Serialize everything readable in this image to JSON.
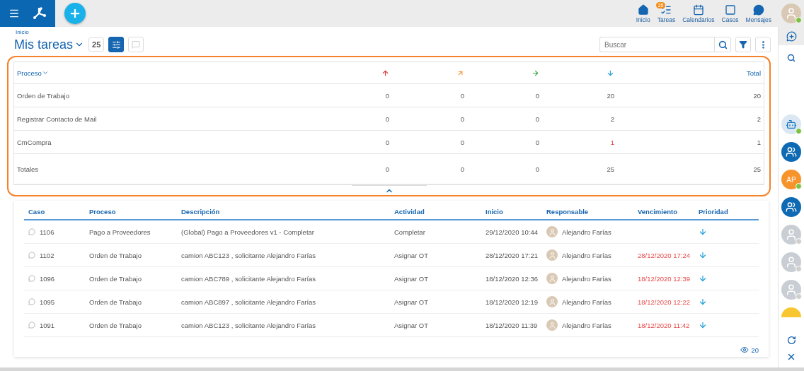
{
  "topbar": {
    "nav": [
      {
        "kind": "home",
        "label": "Inicio"
      },
      {
        "kind": "tasks",
        "label": "Tareas",
        "badge": "25"
      },
      {
        "kind": "calendar",
        "label": "Calendarios"
      },
      {
        "kind": "cases",
        "label": "Casos"
      },
      {
        "kind": "messages",
        "label": "Mensajes"
      }
    ],
    "user": {
      "online": true
    }
  },
  "breadcrumb": "Inicio",
  "title": "Mis tareas",
  "count": "25",
  "search": {
    "placeholder": "Buscar"
  },
  "summary": {
    "process_header": "Proceso",
    "priority_columns": [
      {
        "kind": "urgent"
      },
      {
        "kind": "high"
      },
      {
        "kind": "medium"
      },
      {
        "kind": "low"
      }
    ],
    "total_header": "Total",
    "rows": [
      {
        "name": "Orden de Trabajo",
        "counts": [
          "0",
          "0",
          "0",
          "20"
        ],
        "alerts": [
          false,
          false,
          false,
          false
        ],
        "total": "20"
      },
      {
        "name": "Registrar Contacto de Mail",
        "counts": [
          "0",
          "0",
          "0",
          "2"
        ],
        "alerts": [
          false,
          false,
          false,
          false
        ],
        "total": "2"
      },
      {
        "name": "CmCompra",
        "counts": [
          "0",
          "0",
          "0",
          "1"
        ],
        "alerts": [
          false,
          false,
          false,
          true
        ],
        "total": "1"
      }
    ],
    "totals": {
      "label": "Totales",
      "counts": [
        "0",
        "0",
        "0",
        "25"
      ],
      "total": "25"
    }
  },
  "tasks": {
    "columns": [
      "Caso",
      "Proceso",
      "Descripción",
      "Actividad",
      "Inicio",
      "Responsable",
      "Vencimiento",
      "Prioridad"
    ],
    "rows": [
      {
        "case": "1106",
        "process": "Pago a Proveedores",
        "description": "(Global) Pago a Proveedores v1 - Completar",
        "activity": "Completar",
        "start": "29/12/2020 10:44",
        "responsible": "Alejandro Farías",
        "priority": {
          "kind": "low"
        }
      },
      {
        "case": "1102",
        "process": "Orden de Trabajo",
        "description": "camion ABC123 , solicitante Alejandro Farías",
        "activity": "Asignar OT",
        "start": "28/12/2020 17:21",
        "responsible": "Alejandro Farías",
        "due": "28/12/2020 17:24",
        "priority": {
          "kind": "low"
        }
      },
      {
        "case": "1096",
        "process": "Orden de Trabajo",
        "description": "camion ABC789 , solicitante Alejandro Farías",
        "activity": "Asignar OT",
        "start": "18/12/2020 12:36",
        "responsible": "Alejandro Farías",
        "due": "18/12/2020 12:39",
        "priority": {
          "kind": "low"
        }
      },
      {
        "case": "1095",
        "process": "Orden de Trabajo",
        "description": "camion ABC897 , solicitante Alejandro Farías",
        "activity": "Asignar OT",
        "start": "18/12/2020 12:19",
        "responsible": "Alejandro Farías",
        "due": "18/12/2020 12:22",
        "priority": {
          "kind": "low"
        }
      },
      {
        "case": "1091",
        "process": "Orden de Trabajo",
        "description": "camion ABC123 , solicitante Alejandro Farías",
        "activity": "Asignar OT",
        "start": "18/12/2020 11:39",
        "responsible": "Alejandro Farías",
        "due": "18/12/2020 11:42",
        "priority": {
          "kind": "low"
        }
      }
    ],
    "views": "20"
  },
  "sidebar": {
    "contacts": [
      {
        "kind": "bot",
        "online": true
      },
      {
        "kind": "group"
      },
      {
        "kind": "initials",
        "initials": "AP",
        "online": true
      },
      {
        "kind": "group"
      },
      {
        "kind": "person",
        "online": false
      },
      {
        "kind": "person",
        "online": false
      },
      {
        "kind": "person",
        "online": false
      },
      {
        "kind": "blank"
      }
    ]
  }
}
